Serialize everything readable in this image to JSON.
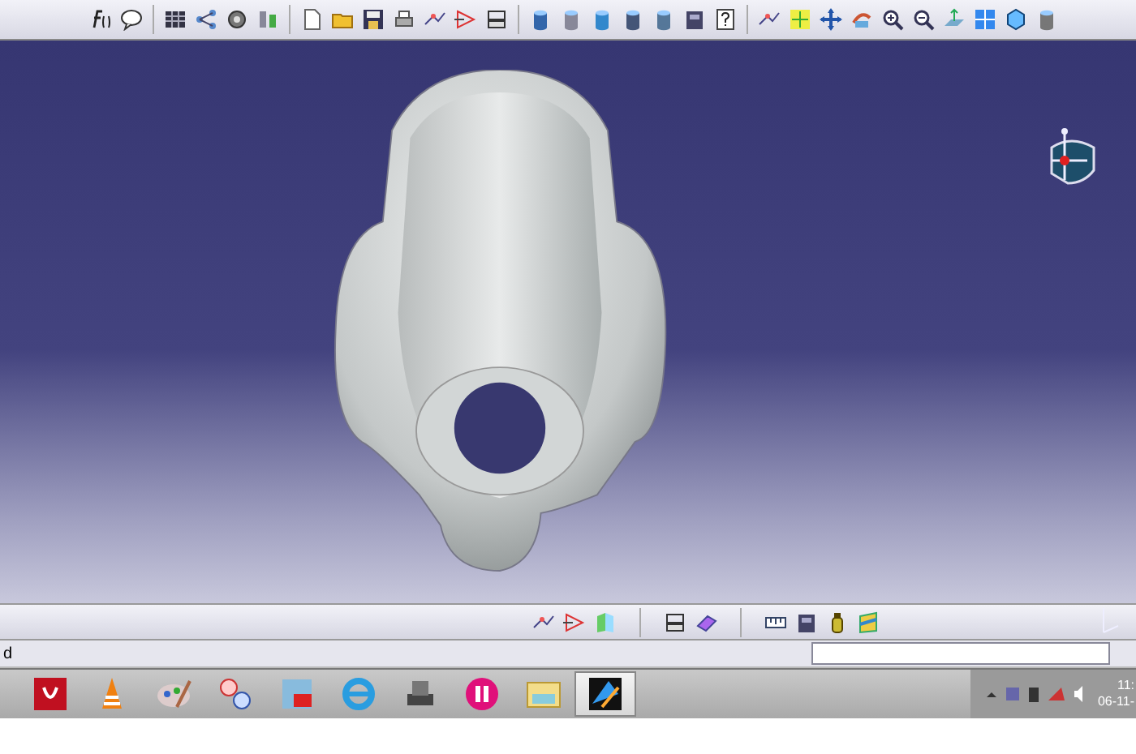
{
  "status_bar": {
    "message": "d"
  },
  "taskbar": {
    "apps": [
      {
        "selected": false
      },
      {
        "selected": false
      },
      {
        "selected": false
      },
      {
        "selected": false
      },
      {
        "selected": false
      },
      {
        "selected": false
      },
      {
        "selected": false
      },
      {
        "selected": false
      },
      {
        "selected": false
      },
      {
        "selected": true
      }
    ],
    "clock": {
      "time": "11:",
      "date": "06-11-"
    }
  }
}
